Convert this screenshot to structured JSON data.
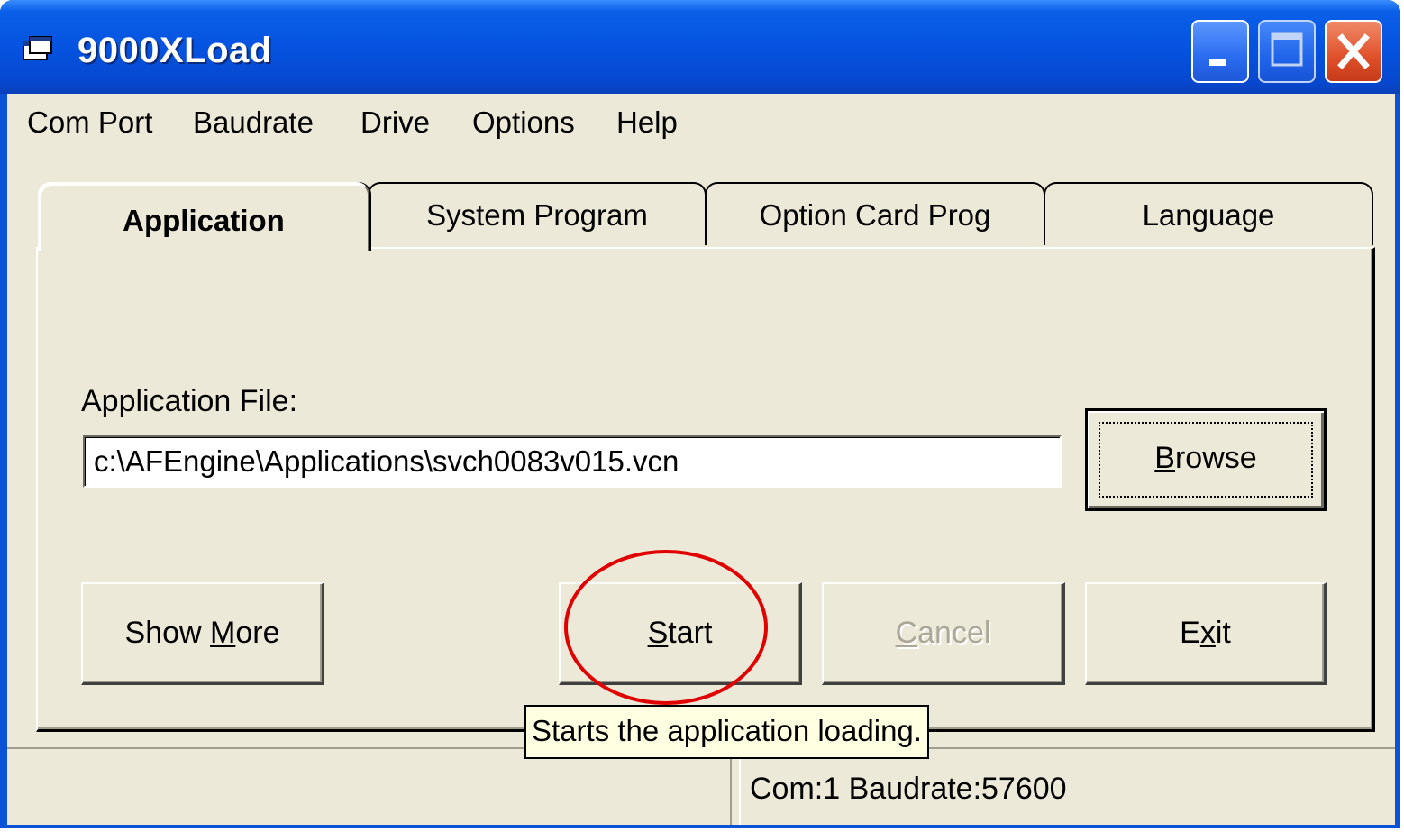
{
  "window": {
    "title": "9000XLoad",
    "icon": "app-window-icon",
    "controls": [
      "minimize-icon",
      "maximize-icon",
      "close-icon"
    ],
    "title_bar_color": "#0553e0",
    "close_button_color": "#e0502a"
  },
  "menu": {
    "items": [
      {
        "label": "Com Port"
      },
      {
        "label": "Baudrate"
      },
      {
        "label": "Drive"
      },
      {
        "label": "Options"
      },
      {
        "label": "Help"
      }
    ]
  },
  "tabs": [
    {
      "label": "Application",
      "selected": true
    },
    {
      "label": "System Program",
      "selected": false
    },
    {
      "label": "Option Card Prog",
      "selected": false
    },
    {
      "label": "Language",
      "selected": false
    }
  ],
  "application_panel": {
    "file_label": "Application File:",
    "file_path": "c:\\AFEngine\\Applications\\svch0083v015.vcn",
    "browse": {
      "pre": "",
      "accel": "B",
      "post": "rowse"
    },
    "show_more": {
      "pre": "Show ",
      "accel": "M",
      "post": "ore"
    },
    "start": {
      "pre": "",
      "accel": "S",
      "post": "tart"
    },
    "cancel": {
      "pre": "",
      "accel": "C",
      "post": "ancel",
      "disabled": true
    },
    "exit": {
      "pre": "E",
      "accel": "x",
      "post": "it"
    }
  },
  "tooltip": {
    "text": "Starts the application loading."
  },
  "annotation": {
    "color": "#e00000"
  },
  "status_bar": {
    "right_text": "Com:1  Baudrate:57600"
  },
  "colors": {
    "dialog_face": "#ece9d8",
    "tooltip_bg": "#ffffe1"
  }
}
